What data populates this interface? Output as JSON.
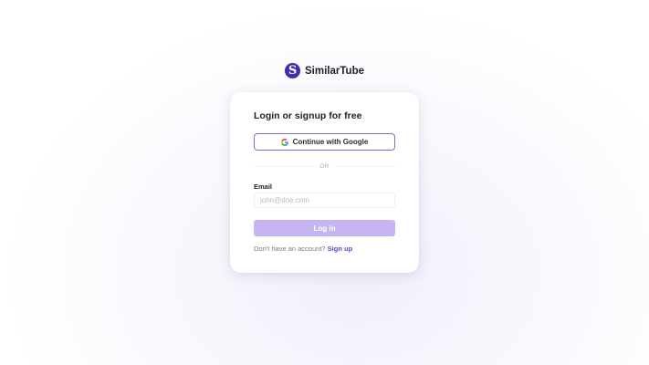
{
  "brand": {
    "logo_letter": "S",
    "name": "SimilarTube",
    "color": "#3f2bb4"
  },
  "card": {
    "title": "Login or signup for free",
    "google_button_label": "Continue with Google",
    "google_icon": "google-g-icon",
    "divider_text": "OR",
    "email_label": "Email",
    "email_placeholder": "john@doe.com",
    "email_value": "",
    "login_button_label": "Log in",
    "login_button_color": "#c7b5f3",
    "signup_prompt": "Don't have an account?",
    "signup_link_label": "Sign up",
    "accent_color": "#6a3fd0"
  }
}
